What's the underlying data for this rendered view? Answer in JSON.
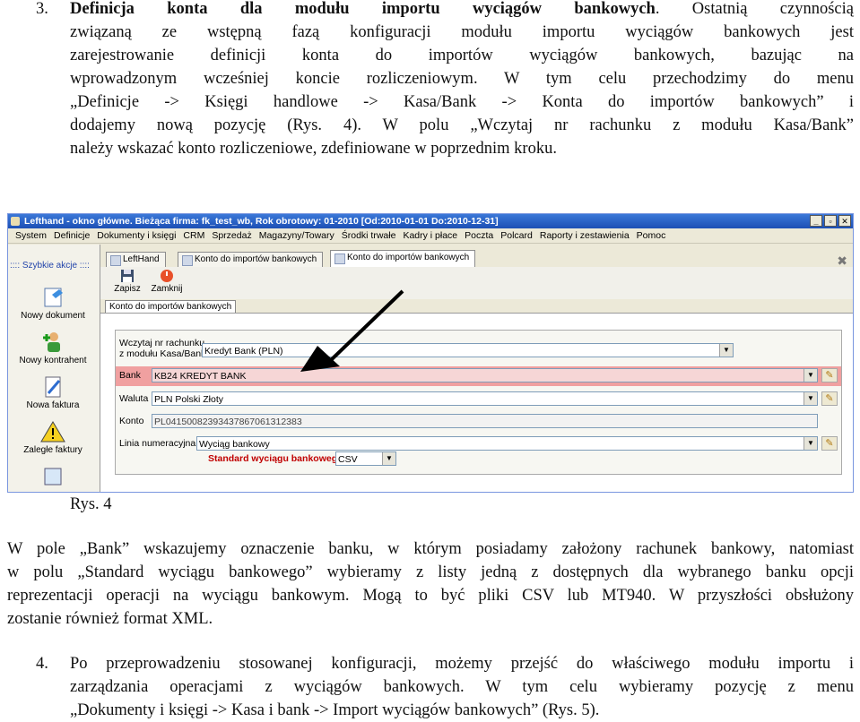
{
  "p3": {
    "number": "3.",
    "bold": "Definicja konta dla modułu importu wyciągów bankowych",
    "l1_rest": ". Ostatnią czynnością",
    "l2": "związaną ze wstępną fazą konfiguracji modułu importu wyciągów bankowych jest",
    "l3": "zarejestrowanie definicji konta do importów wyciągów bankowych, bazując na",
    "l4": "wprowadzonym wcześniej koncie rozliczeniowym. W tym celu przechodzimy do menu",
    "l5": "„Definicje -> Księgi handlowe -> Kasa/Bank -> Konta do importów bankowych” i",
    "l6": "dodajemy nową pozycję (Rys. 4). W polu „Wczytaj nr rachunku z modułu Kasa/Bank”",
    "l7": "należy wskazać konto rozliczeniowe, zdefiniowane w poprzednim kroku."
  },
  "screenshot": {
    "title": "Lefthand - okno główne. Bieżąca firma: fk_test_wb, Rok obrotowy: 01-2010 [Od:2010-01-01 Do:2010-12-31]",
    "menu": [
      "System",
      "Definicje",
      "Dokumenty i księgi",
      "CRM",
      "Sprzedaż",
      "Magazyny/Towary",
      "Środki trwałe",
      "Kadry i płace",
      "Poczta",
      "Polcard",
      "Raporty i zestawienia",
      "Pomoc"
    ],
    "quick_actions_title": ":::: Szybkie akcje ::::",
    "quick_actions": [
      "Nowy dokument",
      "Nowy kontrahent",
      "Nowa faktura",
      "Zaległe faktury"
    ],
    "tabs": [
      "LeftHand",
      "Konto do importów bankowych",
      "Konto do importów bankowych"
    ],
    "toolbar": {
      "save": "Zapisz",
      "close": "Zamknij"
    },
    "form_tab": "Konto do importów bankowych",
    "fields": {
      "load_label_1": "Wczytaj nr rachunku",
      "load_label_2": "z modułu Kasa/Bank",
      "load_value": "Kredyt Bank (PLN)",
      "bank_label": "Bank",
      "bank_value": "KB24 KREDYT BANK",
      "currency_label": "Waluta",
      "currency_value": "PLN Polski Złoty",
      "account_label": "Konto",
      "account_value": "PL04150082393437867061312383",
      "numbering_label": "Linia numeracyjna",
      "numbering_value": "Wyciąg bankowy",
      "standard_label": "Standard wyciągu bankowego",
      "standard_value": "CSV"
    },
    "colors": {
      "titlebar": "#1c4fb5",
      "bank_highlight": "#f0a0a0",
      "standard_label": "#c00000"
    }
  },
  "caption": "Rys. 4",
  "p_bank": {
    "l1": "W pole „Bank” wskazujemy oznaczenie banku, w którym posiadamy założony rachunek bankowy, natomiast",
    "l2": "w polu „Standard wyciągu bankowego” wybieramy z listy jedną z dostępnych dla wybranego banku opcji",
    "l3": "reprezentacji operacji na wyciągu bankowym. Mogą to być pliki CSV lub MT940. W przyszłości obsłużony",
    "l4": "zostanie również format XML."
  },
  "p4": {
    "number": "4.",
    "l1": "Po przeprowadzeniu stosowanej konfiguracji, możemy przejść do właściwego modułu importu i",
    "l2": "zarządzania operacjami z wyciągów bankowych. W tym celu wybieramy pozycję z menu",
    "l3": "„Dokumenty i księgi -> Kasa i bank -> Import wyciągów bankowych” (Rys. 5)."
  }
}
